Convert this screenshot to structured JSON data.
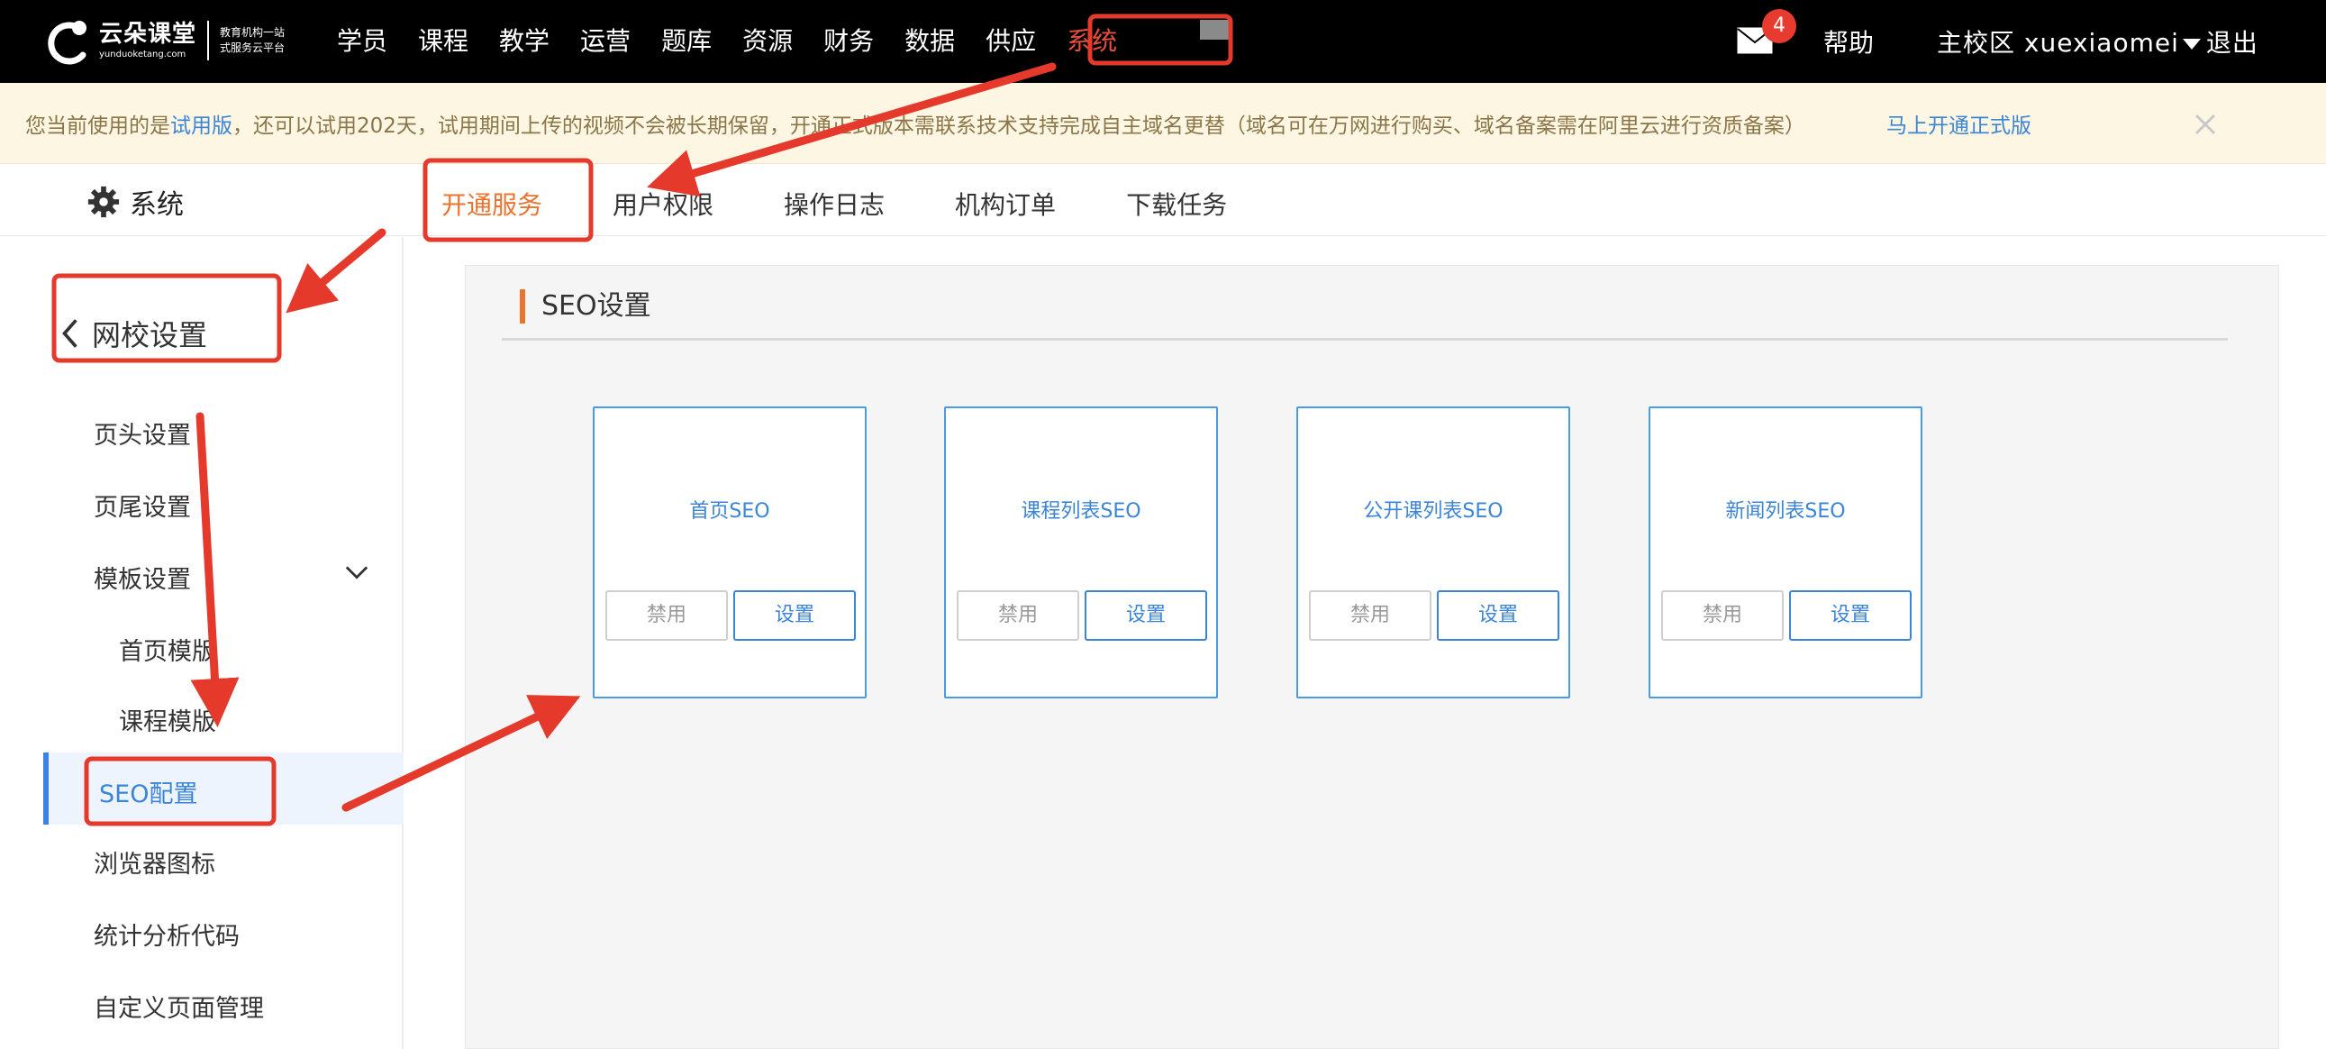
{
  "header": {
    "logo_title": "云朵课堂",
    "logo_url": "yunduoketang.com",
    "logo_slogan_1": "教育机构一站",
    "logo_slogan_2": "式服务云平台",
    "nav": [
      "学员",
      "课程",
      "教学",
      "运营",
      "题库",
      "资源",
      "财务",
      "数据",
      "供应",
      "系统"
    ],
    "active_nav": "系统",
    "mail_count": "4",
    "help": "帮助",
    "campus": "主校区 xuexiaomei",
    "logout": "退出"
  },
  "notice": {
    "text_prefix": "您当前使用的是",
    "version": "试用版",
    "text_suffix": "，还可以试用202天，试用期间上传的视频不会被长期保留，开通正式版本需联系技术支持完成自主域名更替（域名可在万网进行购买、域名备案需在阿里云进行资质备案）",
    "action_link": "马上开通正式版"
  },
  "subheader": {
    "title": "系统",
    "tabs": [
      "开通服务",
      "用户权限",
      "操作日志",
      "机构订单",
      "下载任务"
    ]
  },
  "sidebar": {
    "back_label": "网校设置",
    "items": [
      {
        "label": "页头设置"
      },
      {
        "label": "页尾设置"
      },
      {
        "label": "模板设置"
      },
      {
        "label": "首页模版"
      },
      {
        "label": "课程模版"
      },
      {
        "label": "SEO配置"
      },
      {
        "label": "浏览器图标"
      },
      {
        "label": "统计分析代码"
      },
      {
        "label": "自定义页面管理"
      }
    ]
  },
  "main": {
    "section_title": "SEO设置",
    "cards": [
      {
        "title": "首页SEO",
        "disable_label": "禁用",
        "setting_label": "设置"
      },
      {
        "title": "课程列表SEO",
        "disable_label": "禁用",
        "setting_label": "设置"
      },
      {
        "title": "公开课列表SEO",
        "disable_label": "禁用",
        "setting_label": "设置"
      },
      {
        "title": "新闻列表SEO",
        "disable_label": "禁用",
        "setting_label": "设置"
      }
    ]
  },
  "colors": {
    "topbar": "#000000",
    "accent_orange": "#e8742e",
    "link_blue": "#3c85d6",
    "annotation_red": "#e5392c"
  }
}
